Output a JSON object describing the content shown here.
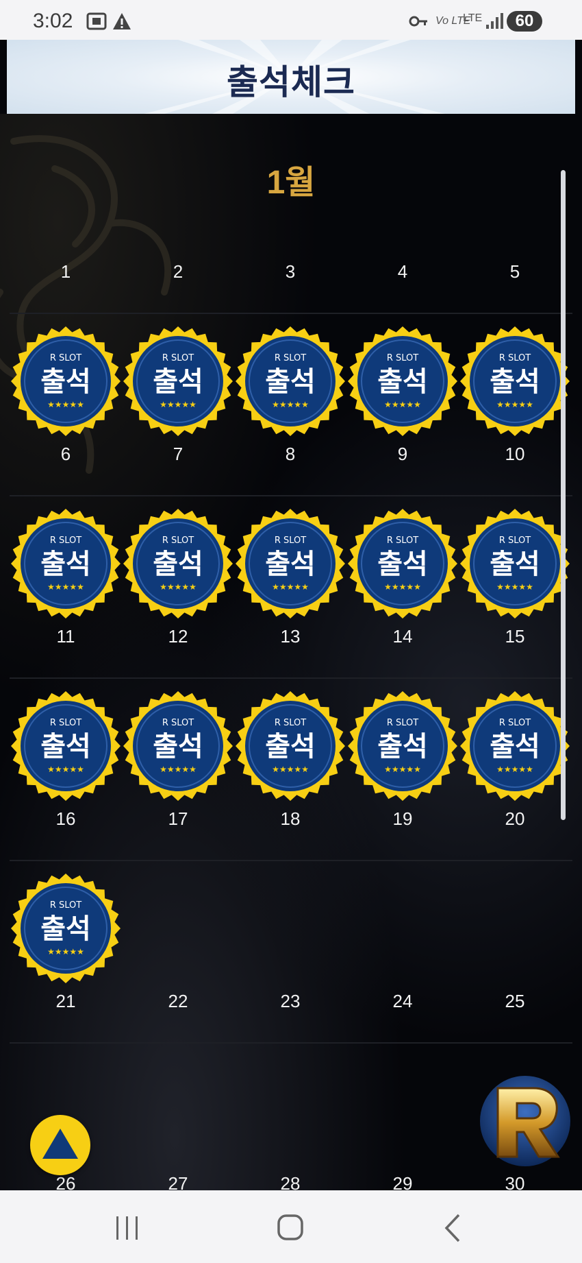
{
  "status_bar": {
    "time": "3:02",
    "icons": [
      "screen-record-icon",
      "warning-icon",
      "vpn-key-icon",
      "volte-icon",
      "lte-icon",
      "signal-icon"
    ],
    "volte_text": "Vo LTE",
    "lte_text": "LTE",
    "battery": "60"
  },
  "header": {
    "title": "출석체크"
  },
  "calendar": {
    "month": "1월",
    "stamp": {
      "brand": "R SLOT",
      "label": "출석",
      "stars": "★★★★★"
    },
    "days": [
      "1",
      "2",
      "3",
      "4",
      "5",
      "6",
      "7",
      "8",
      "9",
      "10",
      "11",
      "12",
      "13",
      "14",
      "15",
      "16",
      "17",
      "18",
      "19",
      "20",
      "21",
      "22",
      "23",
      "24",
      "25",
      "26",
      "27",
      "28",
      "29",
      "30"
    ],
    "attended_count": 16
  },
  "colors": {
    "header_title": "#1b2a52",
    "month": "#d7a640",
    "stamp_gold": "#f7cf14",
    "stamp_navy": "#0f3a7a",
    "top_button": "#f7cf14"
  },
  "nav_bar": {
    "buttons": [
      "recent-apps-icon",
      "home-icon",
      "back-icon"
    ]
  }
}
